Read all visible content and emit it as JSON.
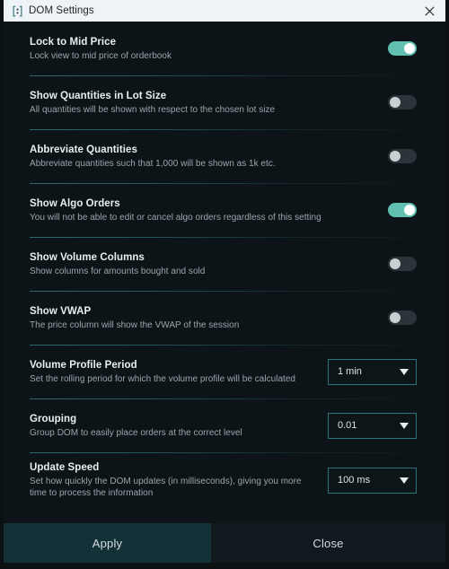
{
  "window": {
    "title": "DOM Settings",
    "title_icon": "dom-brackets-icon",
    "close_icon": "close-icon",
    "accent_teal": "#62c0b1",
    "border_teal": "#2d7179",
    "background": "#0d1418",
    "titlebar_background": "#eef3f7"
  },
  "settings": [
    {
      "title": "Lock to Mid Price",
      "description": "Lock view to mid price of orderbook",
      "control": "toggle",
      "value": "on"
    },
    {
      "title": "Show Quantities in Lot Size",
      "description": "All quantities will be shown with respect to the chosen lot size",
      "control": "toggle",
      "value": "off"
    },
    {
      "title": "Abbreviate Quantities",
      "description": "Abbreviate quantities such that 1,000 will be shown as 1k etc.",
      "control": "toggle",
      "value": "off"
    },
    {
      "title": "Show Algo Orders",
      "description": "You will not be able to edit or cancel algo orders regardless of this setting",
      "control": "toggle",
      "value": "on"
    },
    {
      "title": "Show Volume Columns",
      "description": "Show columns for amounts bought and sold",
      "control": "toggle",
      "value": "off"
    },
    {
      "title": "Show VWAP",
      "description": "The price column will show the VWAP of the session",
      "control": "toggle",
      "value": "off"
    },
    {
      "title": "Volume Profile Period",
      "description": "Set the rolling period for which the volume profile will be calculated",
      "control": "dropdown",
      "value": "1 min"
    },
    {
      "title": "Grouping",
      "description": "Group DOM to easily place orders at the correct level",
      "control": "dropdown",
      "value": "0.01"
    },
    {
      "title": "Update Speed",
      "description": "Set how quickly the DOM updates (in milliseconds), giving you more time to process the information",
      "control": "dropdown",
      "value": "100 ms"
    }
  ],
  "footer": {
    "apply_label": "Apply",
    "close_label": "Close"
  }
}
